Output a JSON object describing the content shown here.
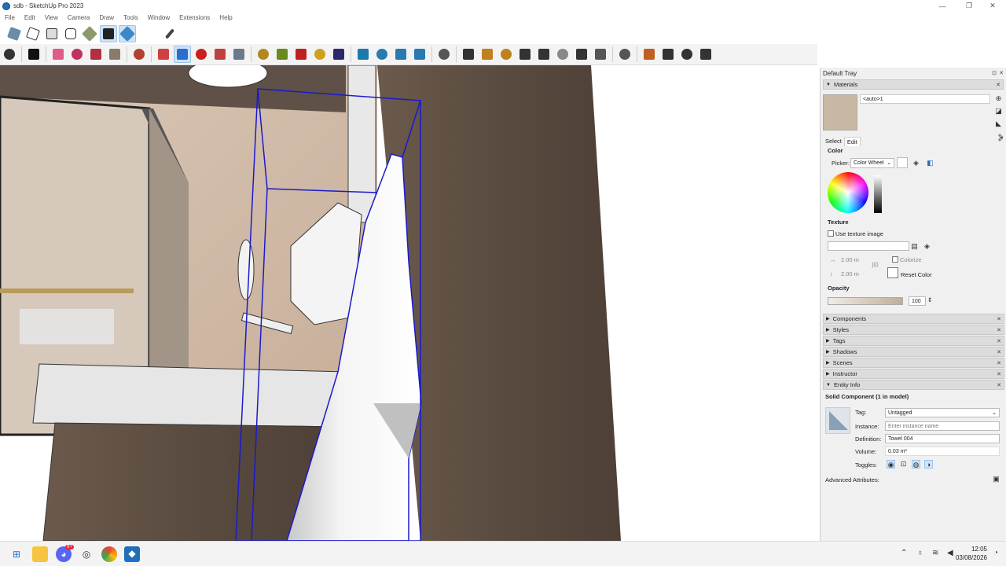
{
  "window": {
    "title": "sdb - SketchUp Pro 2023",
    "minimize": "—",
    "restore": "❐",
    "close": "✕"
  },
  "menu": [
    "File",
    "Edit",
    "View",
    "Camera",
    "Draw",
    "Tools",
    "Window",
    "Extensions",
    "Help"
  ],
  "toolbar_row1_icons": [
    "solid-tools-outer-shell-icon",
    "solid-intersect-icon",
    "solid-union-icon",
    "solid-subtract-icon",
    "solid-trim-icon",
    "solid-split-icon",
    "solid-active-icon"
  ],
  "toolbar_row2_icons": [
    "zoom-icon",
    "select-icon",
    "eraser-icon",
    "pencil-line-icon",
    "arc-icon",
    "rectangle-icon",
    "push-pull-icon",
    "offset-icon",
    "move-icon",
    "rotate-icon",
    "scale-icon",
    "follow-me-icon",
    "tape-measure-icon",
    "paint-bucket-icon",
    "orbit-icon",
    "pan-icon",
    "zoom-extents-icon",
    "section-plane-icon",
    "section-display-icon",
    "section-fill-icon",
    "section-cuts-icon",
    "profile-icon",
    "warehouse-icon",
    "extension-warehouse-icon",
    "share-icon",
    "layout-icon",
    "add-location-icon",
    "geo-icon",
    "photo-texture-icon",
    "cloud-icon",
    "settings-icon",
    "scene-icon",
    "info-icon",
    "cart-icon",
    "account-icon"
  ],
  "tray": {
    "title": "Default Tray",
    "materials": {
      "heading": "Materials",
      "name": "<auto>1",
      "swatch_color": "#c8b7a3",
      "tabs": [
        "Select",
        "Edit"
      ],
      "color_label": "Color",
      "picker_label": "Picker:",
      "picker_value": "Color Wheel",
      "texture_label": "Texture",
      "use_texture": "Use texture image",
      "width": "2.00 m",
      "height": "2.00 m",
      "colorize": "Colorize",
      "reset_color": "Reset Color",
      "opacity_label": "Opacity",
      "opacity_value": "100"
    },
    "sections": [
      "Components",
      "Styles",
      "Tags",
      "Shadows",
      "Scenes",
      "Instructor"
    ],
    "entity_info": {
      "heading": "Entity Info",
      "title": "Solid Component (1 in model)",
      "tag_label": "Tag:",
      "tag_value": "Untagged",
      "instance_label": "Instance:",
      "instance_placeholder": "Enter instance name",
      "definition_label": "Definition:",
      "definition_value": "Towel 004",
      "volume_label": "Volume:",
      "volume_value": "0.03 m³",
      "toggles_label": "Toggles:",
      "advanced": "Advanced Attributes:"
    }
  },
  "taskbar": {
    "apps": [
      "windows-start-icon",
      "file-explorer-icon",
      "discord-icon",
      "obs-icon",
      "chrome-icon",
      "sketchup-icon"
    ],
    "discord_badge": "9+",
    "time": "12:05",
    "date": "03/08/2026"
  },
  "colors": {
    "selection_blue": "#1a1acc",
    "wood_dark": "#5a4a3e",
    "marble": "#d8c6b4",
    "tray_bg": "#f0f0f0"
  }
}
